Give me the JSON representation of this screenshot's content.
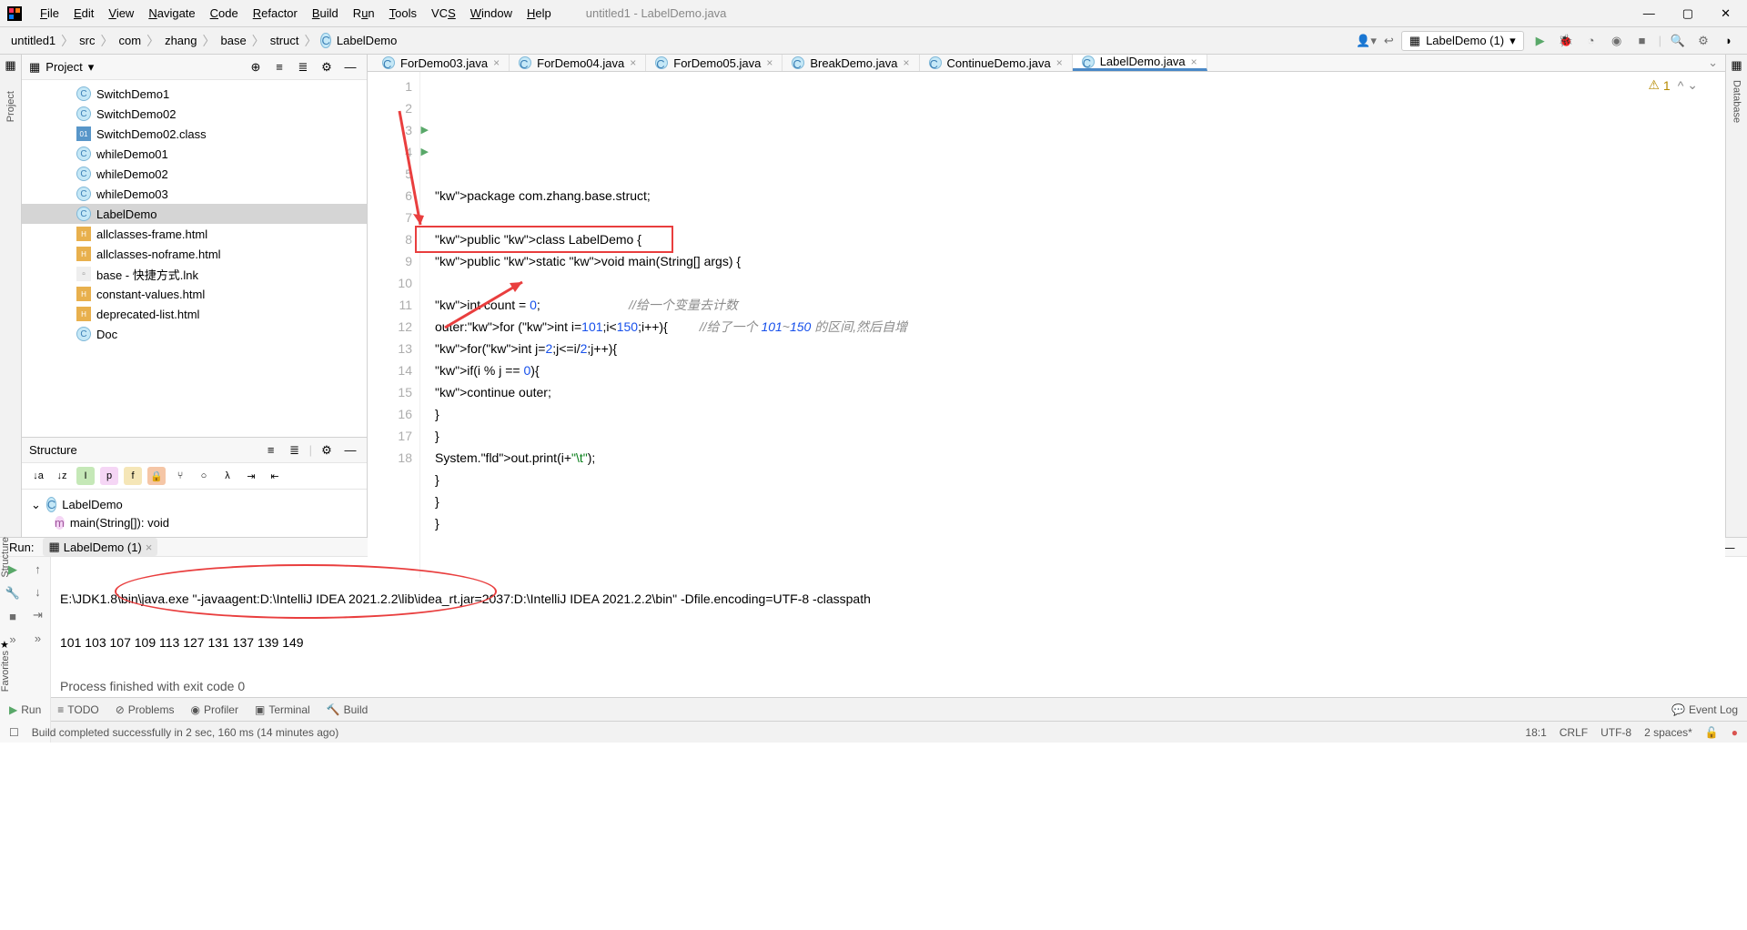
{
  "window": {
    "title": "untitled1 - LabelDemo.java"
  },
  "menu": [
    "File",
    "Edit",
    "View",
    "Navigate",
    "Code",
    "Refactor",
    "Build",
    "Run",
    "Tools",
    "VCS",
    "Window",
    "Help"
  ],
  "breadcrumb": [
    "untitled1",
    "src",
    "com",
    "zhang",
    "base",
    "struct",
    "LabelDemo"
  ],
  "run_config": "LabelDemo (1)",
  "project_panel": {
    "title": "Project"
  },
  "tree": [
    {
      "icon": "java",
      "label": "SwitchDemo1"
    },
    {
      "icon": "java",
      "label": "SwitchDemo02"
    },
    {
      "icon": "class",
      "label": "SwitchDemo02.class"
    },
    {
      "icon": "java",
      "label": "whileDemo01"
    },
    {
      "icon": "java",
      "label": "whileDemo02"
    },
    {
      "icon": "java",
      "label": "whileDemo03"
    },
    {
      "icon": "java",
      "label": "LabelDemo",
      "sel": true
    },
    {
      "icon": "html",
      "label": "allclasses-frame.html"
    },
    {
      "icon": "html",
      "label": "allclasses-noframe.html"
    },
    {
      "icon": "lnk",
      "label": "base - 快捷方式.lnk"
    },
    {
      "icon": "html",
      "label": "constant-values.html"
    },
    {
      "icon": "html",
      "label": "deprecated-list.html"
    },
    {
      "icon": "java",
      "label": "Doc"
    }
  ],
  "structure": {
    "title": "Structure",
    "class": "LabelDemo",
    "method": "main(String[]): void"
  },
  "tabs": [
    {
      "label": "ForDemo03.java"
    },
    {
      "label": "ForDemo04.java"
    },
    {
      "label": "ForDemo05.java"
    },
    {
      "label": "BreakDemo.java"
    },
    {
      "label": "ContinueDemo.java"
    },
    {
      "label": "LabelDemo.java",
      "active": true
    }
  ],
  "code_lines": [
    "package com.zhang.base.struct;",
    "",
    "public class LabelDemo {",
    "public static void main(String[] args) {",
    "",
    "int count = 0;                         //给一个变量去计数",
    "outer:for (int i=101;i<150;i++){         //给了一个 101~150 的区间,然后自增",
    "for(int j=2;j<=i/2;j++){",
    "if(i % j == 0){",
    "continue outer;",
    "}",
    "}",
    "System.out.print(i+\"\\t\");",
    "}",
    "}",
    "}",
    "",
    ""
  ],
  "warnings": "1",
  "run": {
    "title": "Run:",
    "tab": "LabelDemo (1)",
    "lines": [
      "E:\\JDK1.8\\bin\\java.exe \"-javaagent:D:\\IntelliJ IDEA 2021.2.2\\lib\\idea_rt.jar=2037:D:\\IntelliJ IDEA 2021.2.2\\bin\" -Dfile.encoding=UTF-8 -classpath",
      "101 103 107 109 113 127 131 137 139 149",
      "Process finished with exit code 0"
    ]
  },
  "bottom": {
    "run": "Run",
    "todo": "TODO",
    "problems": "Problems",
    "profiler": "Profiler",
    "terminal": "Terminal",
    "build": "Build",
    "eventlog": "Event Log"
  },
  "status": {
    "msg": "Build completed successfully in 2 sec, 160 ms (14 minutes ago)",
    "pos": "18:1",
    "eol": "CRLF",
    "enc": "UTF-8",
    "indent": "2 spaces*"
  },
  "stripes": {
    "project": "Project",
    "structure": "Structure",
    "favorites": "Favorites",
    "database": "Database"
  }
}
